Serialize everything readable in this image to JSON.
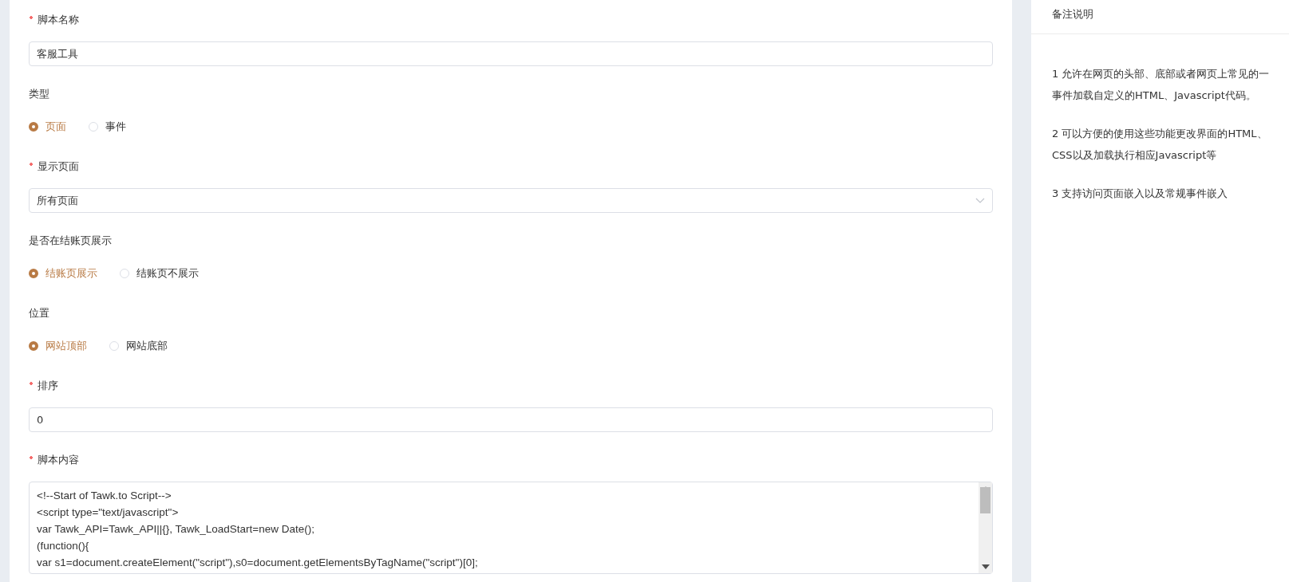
{
  "form": {
    "fields": [
      {
        "kind": "input",
        "label": "脚本名称",
        "required": true,
        "value": "客服工具"
      },
      {
        "kind": "radio",
        "label": "类型",
        "required": false,
        "options": [
          {
            "label": "页面",
            "selected": true
          },
          {
            "label": "事件",
            "selected": false
          }
        ]
      },
      {
        "kind": "select",
        "label": "显示页面",
        "required": true,
        "value": "所有页面"
      },
      {
        "kind": "radio",
        "label": "是否在结账页展示",
        "required": false,
        "options": [
          {
            "label": "结账页展示",
            "selected": true
          },
          {
            "label": "结账页不展示",
            "selected": false
          }
        ]
      },
      {
        "kind": "radio",
        "label": "位置",
        "required": false,
        "options": [
          {
            "label": "网站顶部",
            "selected": true
          },
          {
            "label": "网站底部",
            "selected": false
          }
        ]
      },
      {
        "kind": "input",
        "label": "排序",
        "required": true,
        "value": "0"
      },
      {
        "kind": "code",
        "label": "脚本内容",
        "required": true,
        "lines": [
          "<!--Start of Tawk.to Script-->",
          "<script type=\"text/javascript\">",
          "var Tawk_API=Tawk_API||{}, Tawk_LoadStart=new Date();",
          "(function(){",
          "var s1=document.createElement(\"script\"),s0=document.getElementsByTagName(\"script\")[0];"
        ]
      }
    ]
  },
  "notes": {
    "title": "备注说明",
    "paragraphs": [
      [
        "1 允许在网页的头部、底部或者网页上常见的一",
        "事件加载自定义的HTML、Javascript代码。"
      ],
      [
        "2 可以方便的使用这些功能更改界面的HTML、",
        "CSS以及加载执行相应Javascript等"
      ],
      [
        "3 支持访问页面嵌入以及常规事件嵌入"
      ]
    ]
  }
}
